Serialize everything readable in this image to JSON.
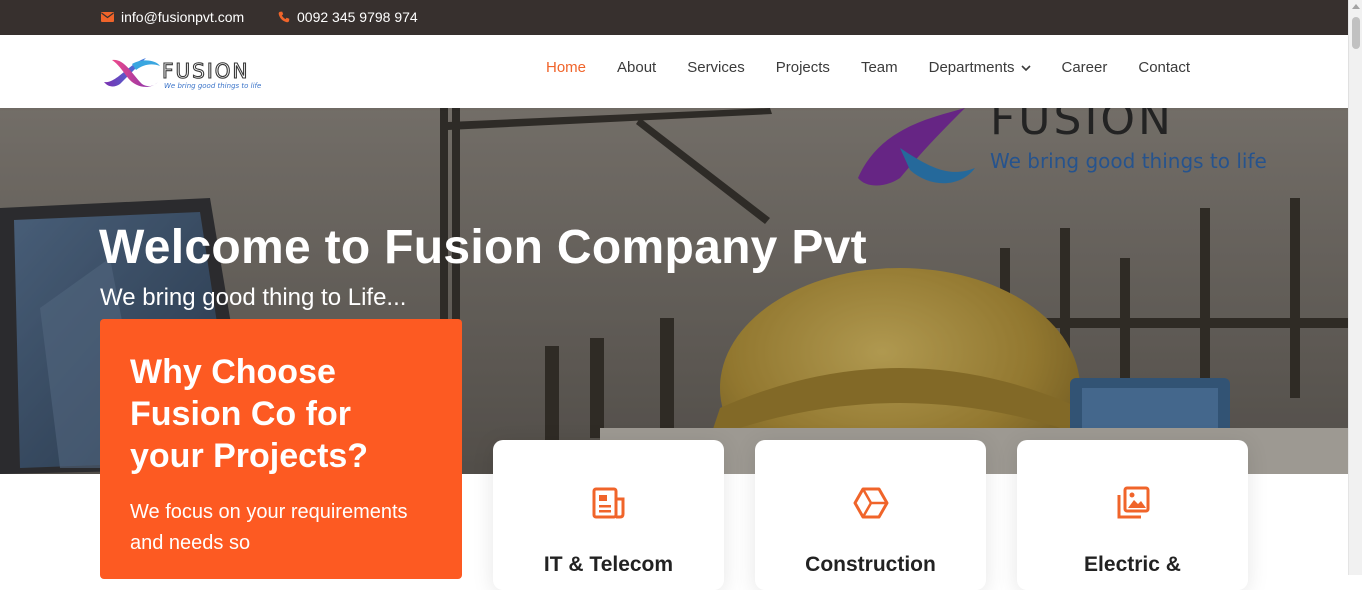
{
  "topbar": {
    "email": "info@fusionpvt.com",
    "phone": "0092 345 9798 974",
    "email_icon": "envelope-icon",
    "phone_icon": "phone-icon"
  },
  "logo": {
    "name": "FUSION",
    "tagline": "We bring good things to life"
  },
  "nav": {
    "items": [
      {
        "label": "Home",
        "active": true
      },
      {
        "label": "About"
      },
      {
        "label": "Services"
      },
      {
        "label": "Projects"
      },
      {
        "label": "Team"
      },
      {
        "label": "Departments",
        "has_dropdown": true
      },
      {
        "label": "Career"
      },
      {
        "label": "Contact"
      }
    ]
  },
  "hero": {
    "title": "Welcome to Fusion Company Pvt",
    "subtitle": "We bring good thing to Life...",
    "background_logo_text": "FUSION",
    "background_tagline": "We bring good things to life"
  },
  "why": {
    "heading": "Why Choose Fusion Co for your Projects?",
    "text": "We focus on your requirements and needs so"
  },
  "cards": [
    {
      "title": "IT & Telecom",
      "icon": "newspaper-icon"
    },
    {
      "title": "Construction",
      "icon": "hexagon-box-icon"
    },
    {
      "title": "Electric &",
      "icon": "images-icon"
    }
  ],
  "colors": {
    "accent": "#f0642a",
    "orange_box": "#fd5a22",
    "topbar": "#37302e"
  }
}
